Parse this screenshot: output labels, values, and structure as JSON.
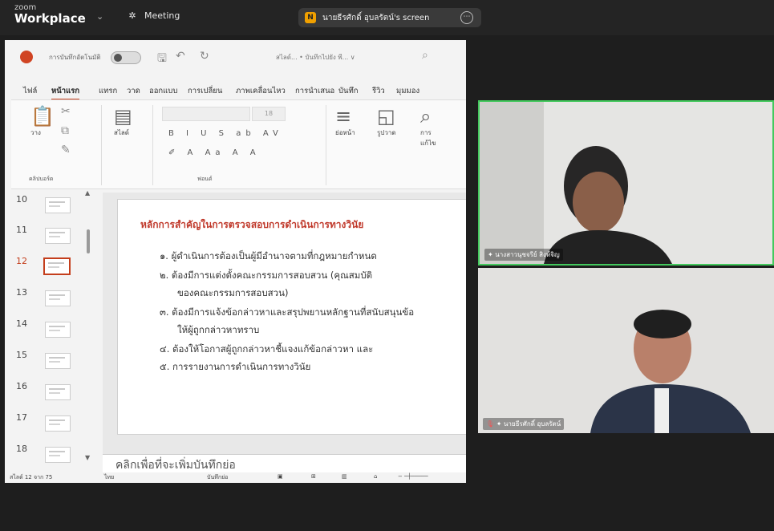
{
  "app": {
    "brand_small": "zoom",
    "brand_name": "Workplace",
    "meeting_label": "Meeting",
    "share_name": "นายธีรศักดิ์ อุบลรัตน์'s screen",
    "share_initial": "N"
  },
  "ppt": {
    "autosave": "การบันทึกอัตโนมัติ",
    "filename": "สไลด์... • บันทึกไปยัง พี... ∨",
    "tabs": [
      "ไฟล์",
      "หน้าแรก",
      "แทรก",
      "วาด",
      "ออกแบบ",
      "การเปลี่ยน",
      "ภาพเคลื่อนไหว",
      "การนำเสนอ",
      "บันทึก",
      "รีวิว",
      "มุมมอง"
    ],
    "active_tab": "หน้าแรก",
    "ribbon": {
      "paste": "วาง",
      "clipboard": "คลิปบอร์ด",
      "slides": "สไลด์",
      "font_group": "ฟอนต์",
      "font_size": "18",
      "paragraph": "ย่อหน้า",
      "shapes": "รูปวาด",
      "edit_1": "การ",
      "edit_2": "แก้ไข"
    },
    "thumbnails": [
      "10",
      "11",
      "12",
      "13",
      "14",
      "15",
      "16",
      "17",
      "18"
    ],
    "current_slide": "12",
    "slide": {
      "title": "หลักการสำคัญในการตรวจสอบการดำเนินการทางวินัย",
      "items": [
        "๑. ผู้ดำเนินการต้องเป็นผู้มีอำนาจตามที่กฎหมายกำหนด",
        "๒. ต้องมีการแต่งตั้งคณะกรรมการสอบสวน (คุณสมบัติ",
        "ของคณะกรรมการสอบสวน)",
        "๓. ต้องมีการแจ้งข้อกล่าวหาและสรุปพยานหลักฐานที่สนับสนุนข้อ",
        "ให้ผู้ถูกกล่าวหาทราบ",
        "๔. ต้องให้โอกาสผู้ถูกกล่าวหาชี้แจงแก้ข้อกล่าวหา และ",
        "๕. การรายงานการดำเนินการทางวินัย"
      ]
    },
    "notes_placeholder": "คลิกเพื่อที่จะเพิ่มบันทึกย่อ",
    "status": {
      "slide_count": "สไลด์ 12 จาก 75",
      "language": "ไทย",
      "notes": "บันทึกย่อ"
    }
  },
  "participants": [
    {
      "name": "นางสาวนุชจรีย์ สิงห์จิญ"
    },
    {
      "name": "นายธีรศักดิ์ อุบลรัตน์"
    }
  ],
  "colors": {
    "active_speaker": "#43c95d",
    "ppt_accent": "#c43e1c",
    "slide_title": "#c0392b"
  }
}
